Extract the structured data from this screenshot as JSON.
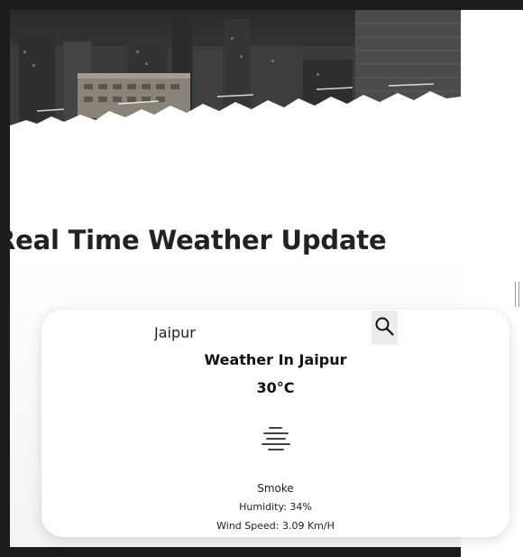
{
  "page": {
    "title": "Real Time Weather Update"
  },
  "search": {
    "value": "Jaipur",
    "button_icon": "search-icon"
  },
  "weather": {
    "heading": "Weather In Jaipur",
    "temperature": "30°C",
    "condition_icon": "smoke-icon",
    "condition": "Smoke",
    "humidity": "Humidity: 34%",
    "wind_speed": "Wind Speed: 3.09 Km/H"
  },
  "colors": {
    "frame": "#1c1c1c",
    "text": "#222222",
    "card_background": "#ffffff",
    "search_button": "#ececec"
  }
}
